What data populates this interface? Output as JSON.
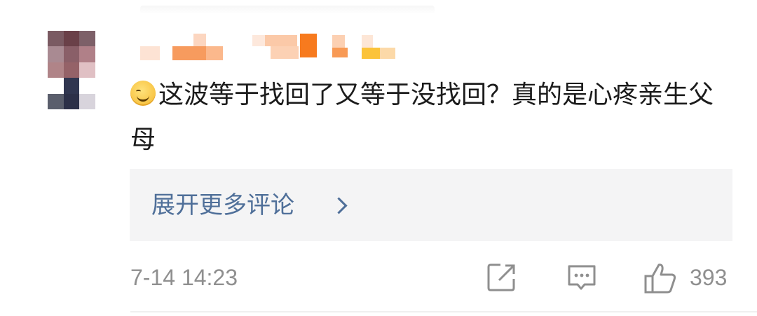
{
  "comment": {
    "text": "这波等于找回了又等于没找回？真的是心疼亲生父母",
    "emoji_icon": "squint-smile-emoji-icon"
  },
  "expand": {
    "label": "展开更多评论",
    "icon": "chevron-right-icon"
  },
  "meta": {
    "timestamp": "7-14 14:23",
    "like_count": "393"
  },
  "icons": {
    "share": "share-icon",
    "reply": "comment-icon",
    "like": "thumbs-up-icon"
  },
  "colors": {
    "text": "#1b1b1b",
    "link": "#4f6f99",
    "muted": "#8f8f8f",
    "expand_bg": "#f4f4f5"
  }
}
